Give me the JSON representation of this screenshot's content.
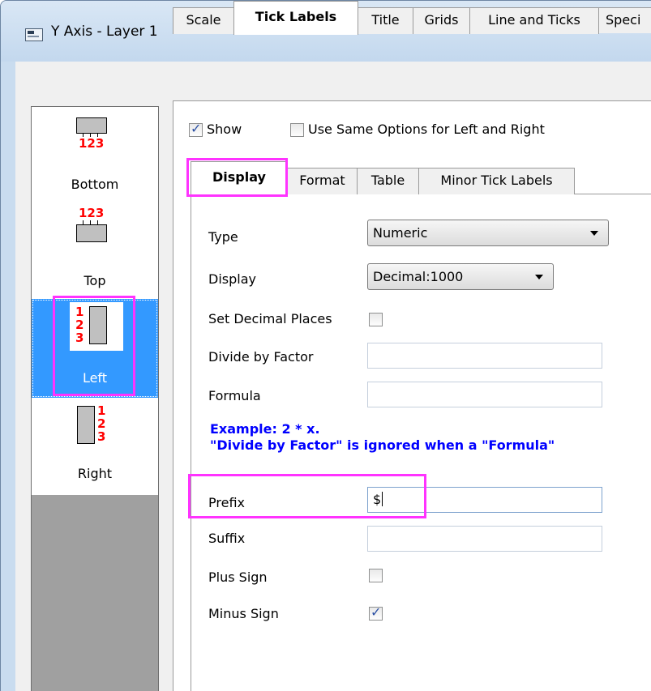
{
  "window": {
    "title": "Y Axis - Layer 1"
  },
  "axes_panel": {
    "items": [
      {
        "label": "Bottom",
        "digits": "123",
        "selected": false
      },
      {
        "label": "Top",
        "digits": "123",
        "selected": false
      },
      {
        "label": "Left",
        "digits": "123",
        "selected": true
      },
      {
        "label": "Right",
        "digits": "123",
        "selected": false
      }
    ]
  },
  "main_tabs": [
    {
      "label": "Scale",
      "active": false
    },
    {
      "label": "Tick Labels",
      "active": true
    },
    {
      "label": "Title",
      "active": false
    },
    {
      "label": "Grids",
      "active": false
    },
    {
      "label": "Line and Ticks",
      "active": false
    },
    {
      "label": "Speci",
      "active": false
    }
  ],
  "tick_labels": {
    "show_label": "Show",
    "show_checked": true,
    "same_options_label": "Use Same Options for Left and Right",
    "same_options_checked": false
  },
  "sub_tabs": [
    {
      "label": "Display",
      "active": true
    },
    {
      "label": "Format",
      "active": false
    },
    {
      "label": "Table",
      "active": false
    },
    {
      "label": "Minor Tick Labels",
      "active": false
    }
  ],
  "display": {
    "type_label": "Type",
    "type_value": "Numeric",
    "display_label": "Display",
    "display_value": "Decimal:1000",
    "set_decimal_label": "Set Decimal Places",
    "set_decimal_checked": false,
    "divide_label": "Divide by Factor",
    "divide_value": "",
    "formula_label": "Formula",
    "formula_value": "",
    "example_line1": "Example: 2 * x.",
    "example_line2": "\"Divide by Factor\" is ignored when a \"Formula\"",
    "prefix_label": "Prefix",
    "prefix_value": "$",
    "suffix_label": "Suffix",
    "suffix_value": "",
    "plus_sign_label": "Plus Sign",
    "plus_sign_checked": false,
    "minus_sign_label": "Minus Sign",
    "minus_sign_checked": true
  },
  "highlight_color": "#ff33ff",
  "selection_color": "#3399ff"
}
